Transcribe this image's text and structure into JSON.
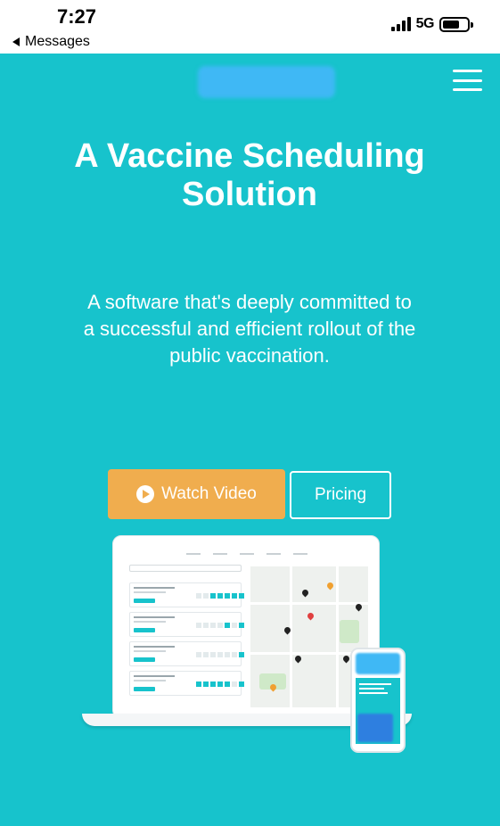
{
  "status_bar": {
    "time": "7:27",
    "back_label": "Messages",
    "network": "5G"
  },
  "header": {
    "menu_icon": "hamburger-menu-icon"
  },
  "hero": {
    "title": "A Vaccine Scheduling Solution",
    "subtitle": "A software that's deeply committed to a successful and efficient rollout of the public vaccination.",
    "watch_video_label": "Watch Video",
    "pricing_label": "Pricing"
  },
  "colors": {
    "hero_background": "#17c3cc",
    "watch_button": "#f0ad4e",
    "text": "#ffffff"
  }
}
